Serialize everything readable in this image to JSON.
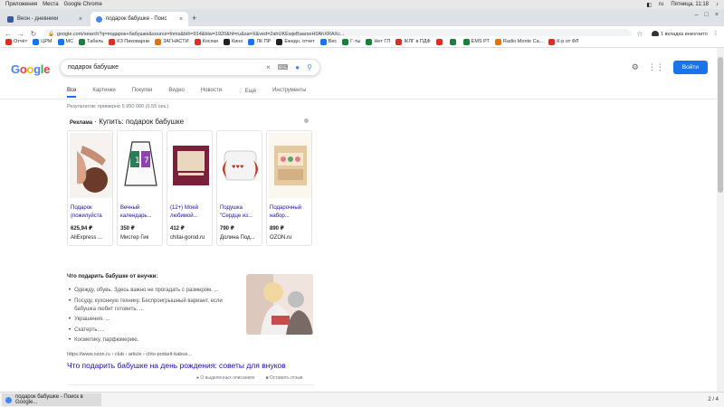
{
  "system_bar": {
    "apps": "Приложения",
    "places": "Места",
    "browser": "Google Chrome",
    "lang": "ru",
    "clock": "Пятница, 11:18"
  },
  "tabs": [
    {
      "title": "Веон - дневники",
      "active": false
    },
    {
      "title": "подарок бабушке - Поис",
      "active": true
    }
  ],
  "url": "google.com/search?q=подарок+бабушке&source=lnms&bih=914&biw=1920&hl=ru&sa=X&ved=2ahUKEwjeBaarseH0AhXRAXc...",
  "incognito_label": "1 вкладка инкогнито",
  "bookmarks": [
    {
      "label": "Отчёт",
      "color": "#d93025"
    },
    {
      "label": "ЦРМ",
      "color": "#1a73e8"
    },
    {
      "label": "МС",
      "color": "#1a73e8"
    },
    {
      "label": "Табель",
      "color": "#188038"
    },
    {
      "label": "КЗ Пиковарни",
      "color": "#d93025"
    },
    {
      "label": "ЗАГНАСТИ",
      "color": "#e37400"
    },
    {
      "label": "Косяки",
      "color": "#d93025"
    },
    {
      "label": "Кино",
      "color": "#202124"
    },
    {
      "label": "ЛК ПР",
      "color": "#1a73e8"
    },
    {
      "label": "Ежедн. отчет",
      "color": "#202124"
    },
    {
      "label": "Вес",
      "color": "#1a73e8"
    },
    {
      "label": "Г-ты",
      "color": "#188038"
    },
    {
      "label": "Нет ГП",
      "color": "#188038"
    },
    {
      "label": "ЖЛГ в ПДФ",
      "color": "#d93025"
    },
    {
      "label": "",
      "color": "#d93025"
    },
    {
      "label": "",
      "color": "#188038"
    },
    {
      "label": "EMS РТ",
      "color": "#188038"
    },
    {
      "label": "Radio Monte Ca...",
      "color": "#e37400"
    },
    {
      "label": "К-р от ФЛ",
      "color": "#d93025"
    }
  ],
  "google": {
    "logo_letters": [
      "G",
      "o",
      "o",
      "g",
      "l",
      "e"
    ],
    "query": "подарок бабушке",
    "signin": "Войти",
    "search_tabs": [
      "Все",
      "Картинки",
      "Покупки",
      "Видео",
      "Новости",
      "⋮ Ещё",
      "Инструменты"
    ],
    "stats": "Результатов: примерно 5 950 000 (0,55 сек.)",
    "ad_label": "Реклама",
    "ad_heading": "· Купить: подарок бабушке"
  },
  "products": [
    {
      "title": "Подарок (пожилуйста",
      "price": "625,94 ₽",
      "seller": "AliExpress ..."
    },
    {
      "title": "Вечный календарь...",
      "price": "350 ₽",
      "seller": "Мистер Гик"
    },
    {
      "title": "(12+) Моей любимой...",
      "price": "412 ₽",
      "seller": "chitai-gorod.ru"
    },
    {
      "title": "Подушка \"Сердце из...",
      "price": "790 ₽",
      "seller": "Долина Под..."
    },
    {
      "title": "Подарочный набор...",
      "price": "890 ₽",
      "seller": "OZON.ru"
    }
  ],
  "snippet": {
    "title": "Что подарить бабушке от внучки:",
    "items": [
      "Одежду, обувь. Здесь важно не прогадать с размером. ...",
      "Посуду, кухонную технику. Беспроигрышный вариант, если бабушка любит готовить. ...",
      "Украшения. ...",
      "Скатерть. ...",
      "Косметику, парфюмерию."
    ],
    "cite": "https://www.ozon.ru › club › article › chto-podarit-babus...",
    "link": "Что подарить бабушке на день рождения: советы для внуков",
    "about": "О выделенных описаниях",
    "feedback": "Оставить отзыв"
  },
  "taskbar": {
    "item": "подарок бабушке - Поиск в Google...",
    "pager": "2 / 4"
  }
}
